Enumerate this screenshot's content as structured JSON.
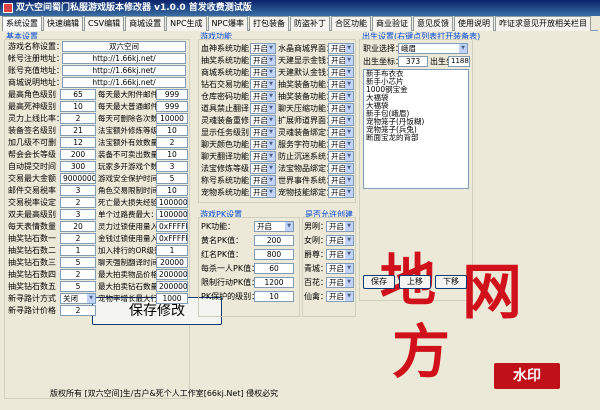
{
  "title": "双六空间蜀门私服游戏版本修改器 v1.0.0 首发收费测试版",
  "tabs": [
    "系统设置",
    "快速编辑",
    "CSV编辑",
    "商城设置",
    "NPC生成",
    "NPC爆率",
    "打包装备",
    "防盗补丁",
    "合区功能",
    "商业验证",
    "意见反馈",
    "使用说明",
    "咋证求意见开放相关栏目"
  ],
  "basic": {
    "title": "基本设置",
    "rows": [
      {
        "label": "游戏名称设置：",
        "value": "双六空间"
      },
      {
        "label": "帐号注册地址：",
        "value": "http://1.66kj.net/"
      },
      {
        "label": "账号充值地址：",
        "value": "http://1.66kj.net/"
      },
      {
        "label": "商城说明地址：",
        "value": "http://1.66kj.net/"
      }
    ],
    "left_fields": [
      {
        "label": "最高角色级别",
        "value": "65"
      },
      {
        "label": "最高死神级别",
        "value": "10"
      },
      {
        "label": "灵力上线比率：",
        "value": "2"
      },
      {
        "label": "装备签名级别",
        "value": "21"
      },
      {
        "label": "加几级不可删",
        "value": "12"
      },
      {
        "label": "帮会会长等级",
        "value": "200"
      },
      {
        "label": "自动提交时间",
        "value": "300"
      },
      {
        "label": "交易最大金额",
        "value": "900000000"
      },
      {
        "label": "邮件交易税率",
        "value": "3"
      },
      {
        "label": "交易税率设定",
        "value": "2"
      },
      {
        "label": "双夫最高级别",
        "value": "3"
      },
      {
        "label": "每天表情数量",
        "value": "20"
      },
      {
        "label": "抽奖钻石数一",
        "value": "2"
      },
      {
        "label": "抽奖钻石数二",
        "value": "1"
      },
      {
        "label": "抽奖钻石数三",
        "value": "5"
      },
      {
        "label": "抽奖钻石数四",
        "value": "2"
      },
      {
        "label": "抽奖钻石数五",
        "value": "5"
      },
      {
        "label": "新寻路计方式",
        "value": "关闭"
      },
      {
        "label": "新寻路计价格",
        "value": "2"
      }
    ],
    "right_fields": [
      {
        "label": "每天最大附件邮件：",
        "value": "999"
      },
      {
        "label": "每天最大普通邮件：",
        "value": "999"
      },
      {
        "label": "每天可删除各次数：",
        "value": "10000"
      },
      {
        "label": "法宝额外修炼等级：",
        "value": "10"
      },
      {
        "label": "法宝额外有效数量：",
        "value": "2"
      },
      {
        "label": "装备不可卖出数量：",
        "value": "10"
      },
      {
        "label": "玩家多开游戏个数：",
        "value": "3"
      },
      {
        "label": "游戏安全保护时间：",
        "value": "5"
      },
      {
        "label": "角色交易限制时间：",
        "value": "10"
      },
      {
        "label": "死亡最大损失经验：",
        "value": "1000000"
      },
      {
        "label": "单个过路费最大：",
        "value": "100000"
      },
      {
        "label": "灵力过锁使用量入：",
        "value": "0xFFFFFF"
      },
      {
        "label": "金钱过锁使用量入：",
        "value": "0xFFFFFF"
      },
      {
        "label": "加入排行的OR级别：",
        "value": "1"
      },
      {
        "label": "聊天强制翻译时间：",
        "value": "20000"
      },
      {
        "label": "最大拍卖物品价格：",
        "value": "200000000"
      },
      {
        "label": "最大拍卖钻石数量：",
        "value": "200000000"
      },
      {
        "label": "宠物率增长最大行：",
        "value": "1000"
      }
    ],
    "save_button": "保存修改"
  },
  "game_func": {
    "title": "游戏功能",
    "left": [
      {
        "label": "血神系统功能：",
        "value": "开启"
      },
      {
        "label": "抽奖系统功能：",
        "value": "开启"
      },
      {
        "label": "商城系统功能：",
        "value": "开启"
      },
      {
        "label": "钻石交易功能：",
        "value": "开启"
      },
      {
        "label": "仓库密码功能：",
        "value": "开启"
      },
      {
        "label": "道具禁止翻译：",
        "value": "开启"
      },
      {
        "label": "灵魂装备重修：",
        "value": "开启"
      },
      {
        "label": "显示任务级别：",
        "value": "开启"
      },
      {
        "label": "聊天颜色功能：",
        "value": "开启"
      },
      {
        "label": "聊天翻译功能：",
        "value": "开启"
      },
      {
        "label": "法宝修炼等级：",
        "value": "开启"
      },
      {
        "label": "称号系统功能：",
        "value": "开启"
      },
      {
        "label": "宠物系统功能：",
        "value": "开启"
      }
    ],
    "right": [
      {
        "label": "水晶商城界面：",
        "value": "开启"
      },
      {
        "label": "天建显示金钱：",
        "value": "开启"
      },
      {
        "label": "天建默认金钱：",
        "value": "开启"
      },
      {
        "label": "抽奖装备功能：",
        "value": "开启"
      },
      {
        "label": "抽奖装备功能：",
        "value": "开启"
      },
      {
        "label": "聊天压缩功能：",
        "value": "开启"
      },
      {
        "label": "扩展师道界面：",
        "value": "开启"
      },
      {
        "label": "灵魂装备绑定：",
        "value": "开启"
      },
      {
        "label": "服务字符功能：",
        "value": "开启"
      },
      {
        "label": "防止沉迷系统：",
        "value": "开启"
      },
      {
        "label": "法宝物品绑定：",
        "value": "开启"
      },
      {
        "label": "世界事件系统：",
        "value": "开启"
      },
      {
        "label": "宠物技能绑定：",
        "value": "开启"
      }
    ]
  },
  "pk": {
    "title": "游戏PK设置",
    "fields": [
      {
        "label": "PK功能：",
        "value": "开启",
        "kind": "select"
      },
      {
        "label": "黄名PK值：",
        "value": "200",
        "kind": "input"
      },
      {
        "label": "红名PK值：",
        "value": "800",
        "kind": "input"
      },
      {
        "label": "每杀一人PK值：",
        "value": "60",
        "kind": "input"
      },
      {
        "label": "限制行动PK值：",
        "value": "1200",
        "kind": "input"
      },
      {
        "label": "PK保护的级别：",
        "value": "10",
        "kind": "input"
      }
    ]
  },
  "create": {
    "title": "是否允许创建",
    "fields": [
      {
        "label": "男咧：",
        "value": "开启"
      },
      {
        "label": "女咧：",
        "value": "开启"
      },
      {
        "label": "爵尊：",
        "value": "开启"
      },
      {
        "label": "青城：",
        "value": "开启"
      },
      {
        "label": "百花：",
        "value": "开启"
      },
      {
        "label": "仙禽：",
        "value": "开启"
      }
    ]
  },
  "birth": {
    "title": "出生设置(右键点列表打开装备表)",
    "job_label": "职业选择：",
    "job_value": "峨眉",
    "x_label": "出生坐标：",
    "x_value": "373",
    "y_label": "出生坐标：",
    "y_value": "1188",
    "items": [
      "新手布衣衣",
      "新手小芯片",
      "1000钢宝金",
      "大福袋",
      "大福袋",
      "新手包(峨眉)",
      "宠物笼子(丹饭糊)",
      "宠物笼子(兵兔)",
      "断面宝龙的背部"
    ],
    "buttons": [
      "保存",
      "上移",
      "下移"
    ]
  },
  "footer": "版权所有 [双六空间]生/古户&死个人工作室[66kj.Net] 侵权必究",
  "watermark": {
    "big": "地方网",
    "stamp": "水印"
  }
}
